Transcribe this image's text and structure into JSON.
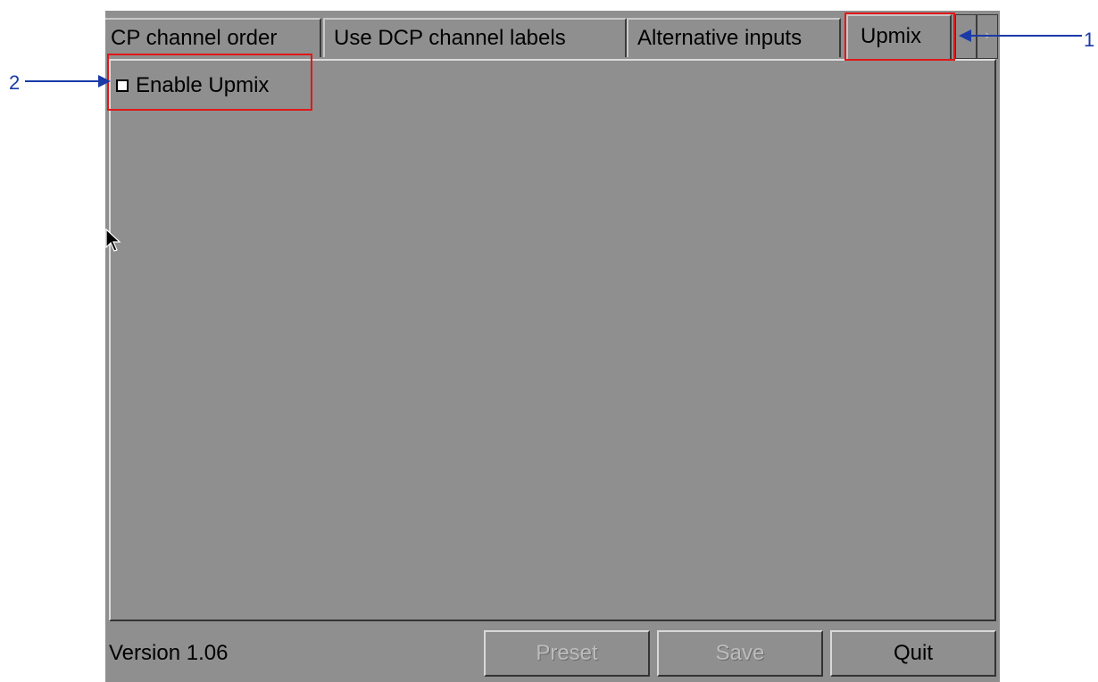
{
  "tabs": [
    {
      "label": "CP channel order"
    },
    {
      "label": "Use DCP channel labels"
    },
    {
      "label": "Alternative inputs"
    },
    {
      "label": "Upmix"
    }
  ],
  "tab_scroll": {
    "left_glyph": "◂",
    "right_glyph": "›"
  },
  "checkbox": {
    "label": "Enable Upmix",
    "checked": false
  },
  "footer": {
    "version": "Version 1.06",
    "buttons": {
      "preset": "Preset",
      "save": "Save",
      "quit": "Quit"
    }
  },
  "annotations": [
    {
      "number": "1",
      "target": "Upmix tab"
    },
    {
      "number": "2",
      "target": "Enable Upmix checkbox"
    }
  ],
  "colors": {
    "panel_bg": "#8f8f8f",
    "highlight": "#e01818",
    "annotation": "#1a3aa8"
  }
}
